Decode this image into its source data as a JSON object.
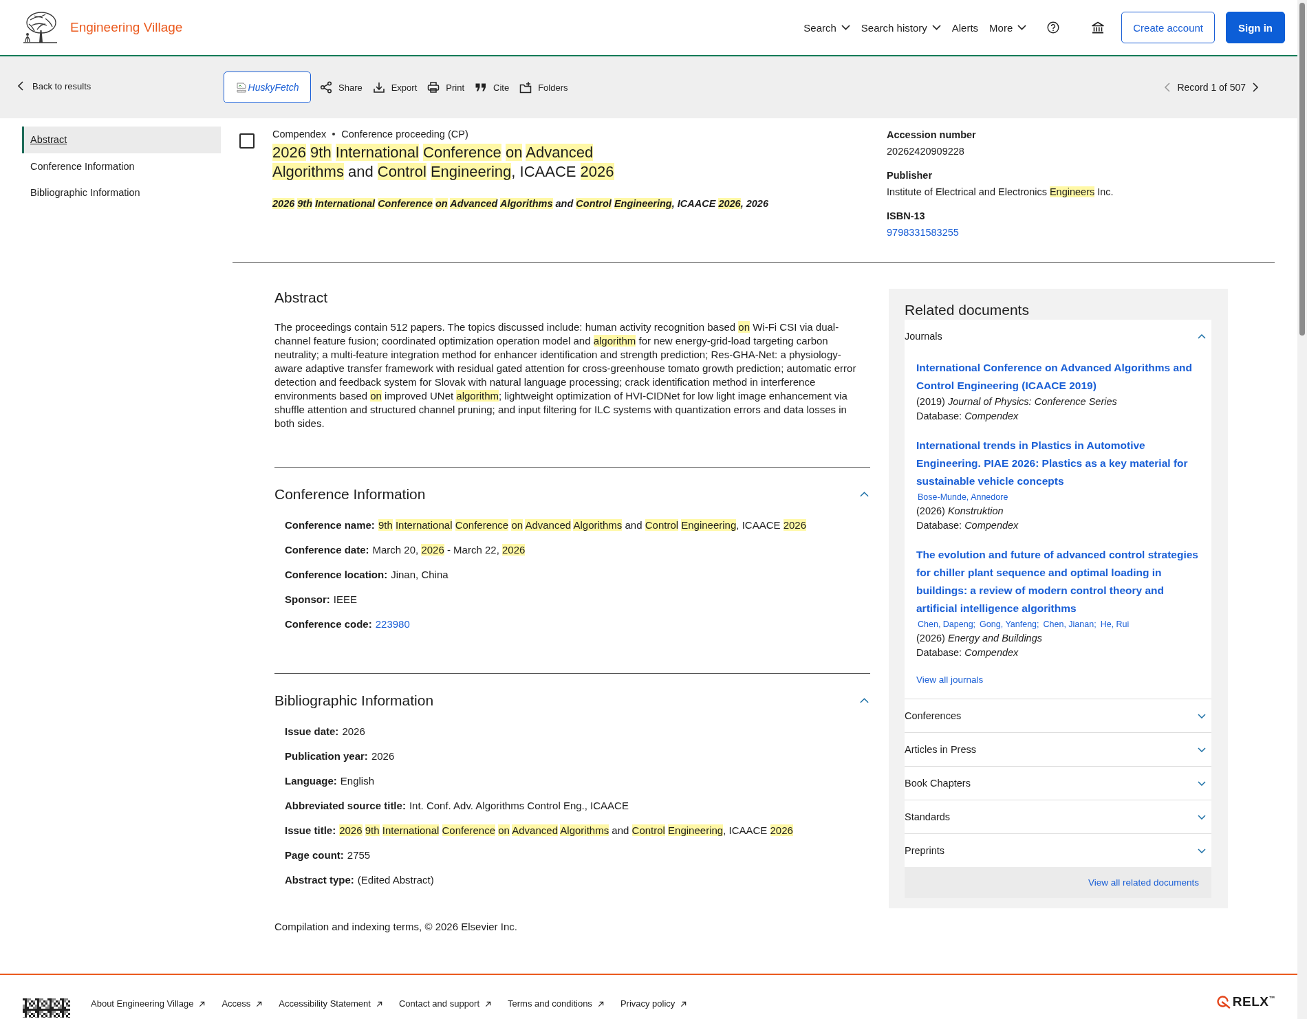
{
  "header": {
    "logo_text": "Engineering Village",
    "nav": [
      {
        "label": "Search",
        "kind": "menu"
      },
      {
        "label": "Search history",
        "kind": "menu"
      },
      {
        "label": "Alerts",
        "kind": "link"
      },
      {
        "label": "More",
        "kind": "menu"
      }
    ],
    "buttons": [
      {
        "label": "Create account",
        "kind": "secondary"
      },
      {
        "label": "Sign in",
        "kind": "primary"
      }
    ]
  },
  "toolbar": {
    "back": "Back to results",
    "image_alt": "HuskyFetch",
    "actions": [
      "Share",
      "Export",
      "Print",
      "Cite",
      "Folders"
    ],
    "record": {
      "label": "Record 1 of 507",
      "prev_disabled": true
    }
  },
  "sidebar": {
    "items": [
      {
        "label": "Abstract",
        "selected": true
      },
      {
        "label": "Conference Information",
        "selected": false
      },
      {
        "label": "Bibliographic Information",
        "selected": false
      }
    ]
  },
  "record": {
    "checked": false,
    "meta": [
      "Compendex",
      "Conference proceeding (CP)"
    ],
    "title": [
      {
        "text": "2026 9th International Conference on Advanced Algorithms",
        "highlighted": true
      },
      {
        "text": " and ",
        "highlighted": false
      },
      {
        "text": "Control Engineering",
        "highlighted": true
      },
      {
        "text": ", ICAACE ",
        "highlighted": false
      },
      {
        "text": "2026",
        "highlighted": true
      }
    ],
    "source": [
      {
        "text": "2026 9th International Conference on Advanced Algorithms",
        "highlighted": true
      },
      {
        "text": " and ",
        "highlighted": false
      },
      {
        "text": "Control Engineering",
        "highlighted": true
      },
      {
        "text": ", ICAACE ",
        "highlighted": false
      },
      {
        "text": "2026",
        "highlighted": true
      },
      {
        "text": ", 2026",
        "highlighted": false
      }
    ],
    "details": [
      {
        "label": "Accession number",
        "kind": "text",
        "value": [
          {
            "text": "20262420909228",
            "highlighted": false
          }
        ]
      },
      {
        "label": "Publisher",
        "kind": "text",
        "value": [
          {
            "text": "Institute of Electrical and Electronics ",
            "highlighted": false
          },
          {
            "text": "Engineers",
            "highlighted": true
          },
          {
            "text": " Inc.",
            "highlighted": false
          }
        ]
      },
      {
        "label": "ISBN-13",
        "kind": "link",
        "value": [
          {
            "text": "9798331583255",
            "highlighted": false
          }
        ]
      }
    ]
  },
  "abstract": {
    "heading": "Abstract",
    "text": [
      {
        "text": "The proceedings contain 512 papers. The topics discussed include: human activity recognition based ",
        "highlighted": false
      },
      {
        "text": "on",
        "highlighted": true
      },
      {
        "text": " Wi-Fi CSI via dual-channel feature fusion; coordinated optimization operation model and ",
        "highlighted": false
      },
      {
        "text": "algorithm",
        "highlighted": true
      },
      {
        "text": " for new energy-grid-load targeting carbon neutrality; a multi-feature integration method for enhancer identification and strength prediction; Res-GHA-Net: a physiology-aware adaptive transfer framework with residual gated attention for cross-greenhouse tomato growth prediction; automatic error detection and feedback system for Slovak with natural language processing; crack identification method in interference environments based ",
        "highlighted": false
      },
      {
        "text": "on",
        "highlighted": true
      },
      {
        "text": " improved UNet ",
        "highlighted": false
      },
      {
        "text": "algorithm",
        "highlighted": true
      },
      {
        "text": "; lightweight optimization of HVI-CIDNet for low light image enhancement via shuffle attention and structured channel pruning; and input filtering for ILC systems with quantization errors and data losses in both sides.",
        "highlighted": false
      }
    ]
  },
  "sections": [
    {
      "heading": "Conference Information",
      "expanded": true,
      "fields": [
        {
          "label": "Conference name:",
          "kind": "text",
          "value": [
            {
              "text": "9th International Conference on Advanced Algorithms",
              "highlighted": true
            },
            {
              "text": " and ",
              "highlighted": false
            },
            {
              "text": "Control Engineering",
              "highlighted": true
            },
            {
              "text": ", ICAACE ",
              "highlighted": false
            },
            {
              "text": "2026",
              "highlighted": true
            }
          ]
        },
        {
          "label": "Conference date:",
          "kind": "text",
          "value": [
            {
              "text": "March 20, ",
              "highlighted": false
            },
            {
              "text": "2026",
              "highlighted": true
            },
            {
              "text": " - March 22, ",
              "highlighted": false
            },
            {
              "text": "2026",
              "highlighted": true
            }
          ]
        },
        {
          "label": "Conference location:",
          "kind": "text",
          "value": [
            {
              "text": "Jinan, China",
              "highlighted": false
            }
          ]
        },
        {
          "label": "Sponsor:",
          "kind": "text",
          "value": [
            {
              "text": "IEEE",
              "highlighted": false
            }
          ]
        },
        {
          "label": "Conference code:",
          "kind": "link",
          "value": [
            {
              "text": "223980",
              "highlighted": false
            }
          ]
        }
      ]
    },
    {
      "heading": "Bibliographic Information",
      "expanded": true,
      "fields": [
        {
          "label": "Issue date:",
          "kind": "text",
          "value": [
            {
              "text": "2026",
              "highlighted": false
            }
          ]
        },
        {
          "label": "Publication year:",
          "kind": "text",
          "value": [
            {
              "text": "2026",
              "highlighted": false
            }
          ]
        },
        {
          "label": "Language:",
          "kind": "text",
          "value": [
            {
              "text": "English",
              "highlighted": false
            }
          ]
        },
        {
          "label": "Abbreviated source title:",
          "kind": "text",
          "value": [
            {
              "text": "Int. Conf. Adv. Algorithms Control Eng., ICAACE",
              "highlighted": false
            }
          ]
        },
        {
          "label": "Issue title:",
          "kind": "text",
          "value": [
            {
              "text": "2026 9th International Conference on Advanced Algorithms",
              "highlighted": true
            },
            {
              "text": " and ",
              "highlighted": false
            },
            {
              "text": "Control Engineering",
              "highlighted": true
            },
            {
              "text": ", ICAACE ",
              "highlighted": false
            },
            {
              "text": "2026",
              "highlighted": true
            }
          ]
        },
        {
          "label": "Page count:",
          "kind": "text",
          "value": [
            {
              "text": "2755",
              "highlighted": false
            }
          ]
        },
        {
          "label": "Abstract type:",
          "kind": "text",
          "value": [
            {
              "text": "(Edited Abstract)",
              "highlighted": false
            }
          ]
        }
      ]
    }
  ],
  "copyright": "Compilation and indexing terms, © 2026 Elsevier Inc.",
  "related": {
    "heading": "Related documents",
    "groups": [
      {
        "label": "Journals",
        "expanded": true,
        "items": [
          {
            "title": "International Conference on Advanced Algorithms and Control Engineering (ICAACE 2019)",
            "source": "(2019) *Journal of Physics: Conference Series*",
            "database": "Database: *Compendex*"
          },
          {
            "title": "International trends in Plastics in Automotive Engineering. PIAE 2026: Plastics as a key material for sustainable vehicle concepts",
            "authors": [
              "Bose-Munde, Annedore"
            ],
            "source": "(2026) *Konstruktion*",
            "database": "Database: *Compendex*"
          },
          {
            "title": "The evolution and future of advanced control strategies for chiller plant sequence and optimal loading in buildings: a review of modern control theory and artificial intelligence algorithms",
            "authors": [
              "Chen, Dapeng;",
              "Gong, Yanfeng;",
              "Chen, Jianan;",
              "He, Rui"
            ],
            "source": "(2026) *Energy and Buildings*",
            "database": "Database: *Compendex*"
          }
        ],
        "view_all": "View all journals"
      },
      {
        "label": "Conferences",
        "expanded": false
      },
      {
        "label": "Articles in Press",
        "expanded": false
      },
      {
        "label": "Book Chapters",
        "expanded": false
      },
      {
        "label": "Standards",
        "expanded": false
      },
      {
        "label": "Preprints",
        "expanded": false
      }
    ],
    "view_all": "View all related documents"
  },
  "footer": {
    "links": [
      "About Engineering Village",
      "Access",
      "Accessibility Statement",
      "Contact and support",
      "Terms and conditions",
      "Privacy policy"
    ],
    "brand": "RELX$^{™}$"
  }
}
